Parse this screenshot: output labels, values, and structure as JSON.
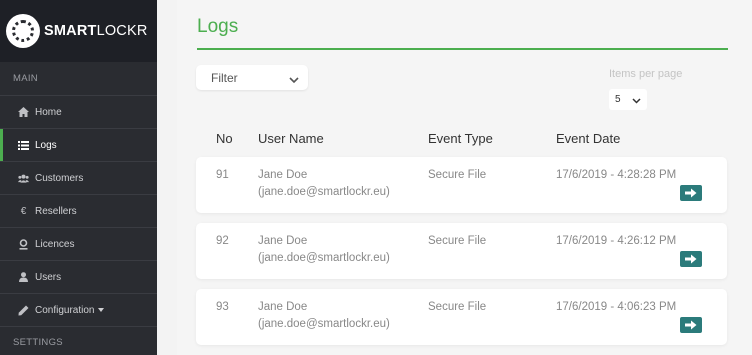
{
  "brand": {
    "name_bold": "SMART",
    "name_rest": "LOCKR"
  },
  "sidebar": {
    "section_main": "MAIN",
    "items": [
      {
        "label": "Home",
        "icon": "home-icon"
      },
      {
        "label": "Logs",
        "icon": "list-icon",
        "active": true
      },
      {
        "label": "Customers",
        "icon": "users-group-icon"
      },
      {
        "label": "Resellers",
        "icon": "euro-icon"
      },
      {
        "label": "Licences",
        "icon": "license-icon"
      },
      {
        "label": "Users",
        "icon": "user-icon"
      },
      {
        "label": "Configuration",
        "icon": "pencil-icon",
        "has_dropdown": true
      }
    ],
    "section_settings": "SETTINGS"
  },
  "main": {
    "title": "Logs",
    "filter_label": "Filter",
    "items_per_page_label": "Items per page",
    "items_per_page_value": "5",
    "table": {
      "headers": [
        "No",
        "User Name",
        "Event Type",
        "Event Date"
      ],
      "rows": [
        {
          "no": "91",
          "name": "Jane Doe",
          "email": "(jane.doe@smartlockr.eu)",
          "event_type": "Secure File",
          "event_date": "17/6/2019 - 4:28:28 PM"
        },
        {
          "no": "92",
          "name": "Jane Doe",
          "email": "(jane.doe@smartlockr.eu)",
          "event_type": "Secure File",
          "event_date": "17/6/2019 - 4:26:12 PM"
        },
        {
          "no": "93",
          "name": "Jane Doe",
          "email": "(jane.doe@smartlockr.eu)",
          "event_type": "Secure File",
          "event_date": "17/6/2019 - 4:06:23 PM"
        }
      ]
    }
  },
  "colors": {
    "accent": "#4cae4f",
    "sidebar_bg": "#2a2c31",
    "button": "#2b7b7b"
  }
}
